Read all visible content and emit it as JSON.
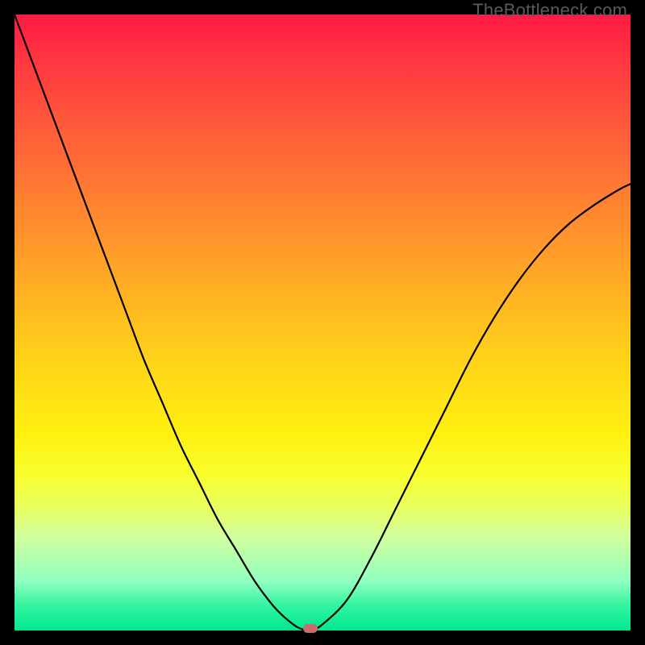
{
  "watermark": "TheBottleneck.com",
  "chart_data": {
    "type": "line",
    "series": [
      {
        "name": "bottleneck-curve",
        "x": [
          0.0,
          0.03,
          0.06,
          0.09,
          0.12,
          0.15,
          0.18,
          0.21,
          0.24,
          0.27,
          0.3,
          0.33,
          0.36,
          0.39,
          0.42,
          0.44,
          0.46,
          0.48,
          0.5,
          0.54,
          0.58,
          0.62,
          0.66,
          0.7,
          0.74,
          0.78,
          0.82,
          0.86,
          0.9,
          0.94,
          0.98,
          1.0
        ],
        "y": [
          1.0,
          0.92,
          0.84,
          0.76,
          0.68,
          0.6,
          0.52,
          0.44,
          0.37,
          0.3,
          0.24,
          0.18,
          0.13,
          0.08,
          0.04,
          0.02,
          0.005,
          0.0,
          0.01,
          0.05,
          0.12,
          0.2,
          0.28,
          0.36,
          0.44,
          0.51,
          0.57,
          0.62,
          0.66,
          0.69,
          0.715,
          0.725
        ]
      }
    ],
    "title": "",
    "xlabel": "",
    "ylabel": "",
    "xlim": [
      0,
      1
    ],
    "ylim": [
      0,
      1
    ],
    "minimum_point": {
      "x": 0.48,
      "y": 0.0
    },
    "gradient_stops": [
      {
        "pos": 0.0,
        "color": "#ff1a44"
      },
      {
        "pos": 0.5,
        "color": "#ffd818"
      },
      {
        "pos": 0.8,
        "color": "#eaff60"
      },
      {
        "pos": 1.0,
        "color": "#00e890"
      }
    ],
    "notes": "Axes unlabeled in source image; x and y are normalized 0–1. y=0 at bottom (green) = no bottleneck, y=1 at top (red) = high bottleneck."
  }
}
